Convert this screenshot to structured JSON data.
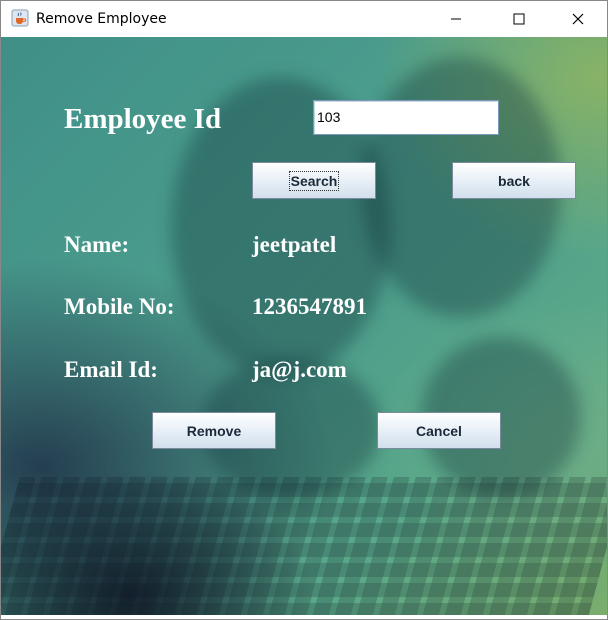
{
  "window": {
    "title": "Remove Employee",
    "icons": {
      "app": "java-cup-icon",
      "minimize": "minimize-icon",
      "maximize": "maximize-icon",
      "close": "close-icon"
    }
  },
  "form": {
    "employee_id_label": "Employee Id",
    "employee_id_value": "103",
    "search_label": "Search",
    "back_label": "back",
    "name_label": "Name:",
    "name_value": "jeetpatel",
    "mobile_label": "Mobile No:",
    "mobile_value": "1236547891",
    "email_label": "Email Id:",
    "email_value": "ja@j.com",
    "remove_label": "Remove",
    "cancel_label": "Cancel"
  },
  "colors": {
    "background": "#4a9c8c",
    "text": "#ffffff",
    "button_text": "#1b2a3a"
  }
}
